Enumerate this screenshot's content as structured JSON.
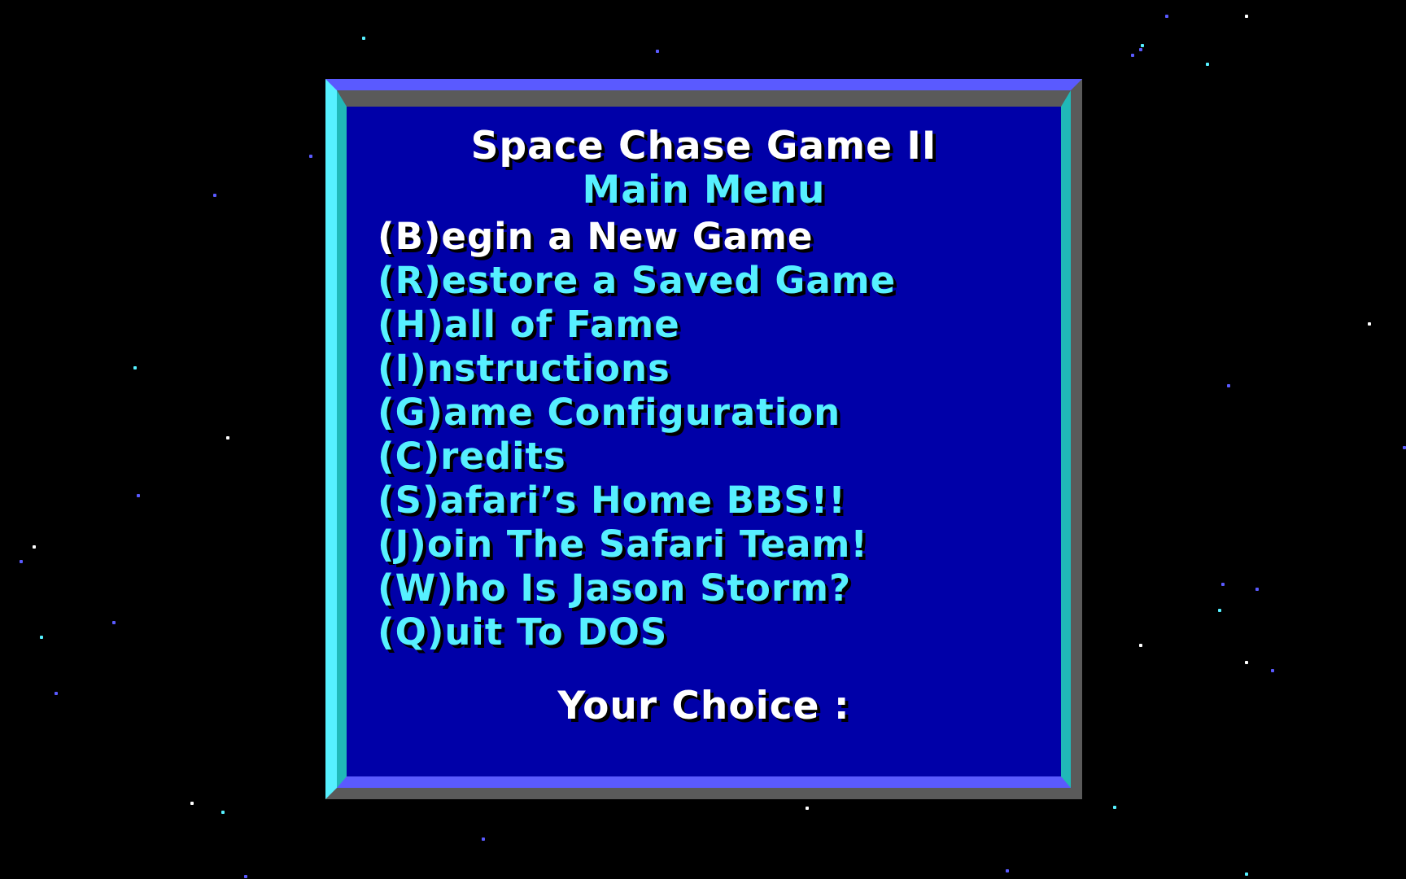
{
  "game": {
    "title": "Space Chase Game II",
    "subtitle": "Main Menu",
    "prompt": "Your Choice :"
  },
  "menu": {
    "selected_index": 0,
    "items": [
      {
        "label": "(B)egin a New Game"
      },
      {
        "label": "(R)estore a Saved Game"
      },
      {
        "label": "(H)all of Fame"
      },
      {
        "label": "(I)nstructions"
      },
      {
        "label": "(G)ame Configuration"
      },
      {
        "label": "(C)redits"
      },
      {
        "label": "(S)afari’s Home BBS!!"
      },
      {
        "label": "(J)oin The Safari Team!"
      },
      {
        "label": "(W)ho Is Jason Storm?"
      },
      {
        "label": "(Q)uit To DOS"
      }
    ]
  },
  "colors": {
    "background": "#000000",
    "panel": "#0000a8",
    "menu_text": "#56f0ff",
    "highlight_text": "#ffffff",
    "frame_blue": "#5a5aff",
    "frame_cyan": "#56f0ff",
    "frame_gray": "#5a5a5a"
  }
}
